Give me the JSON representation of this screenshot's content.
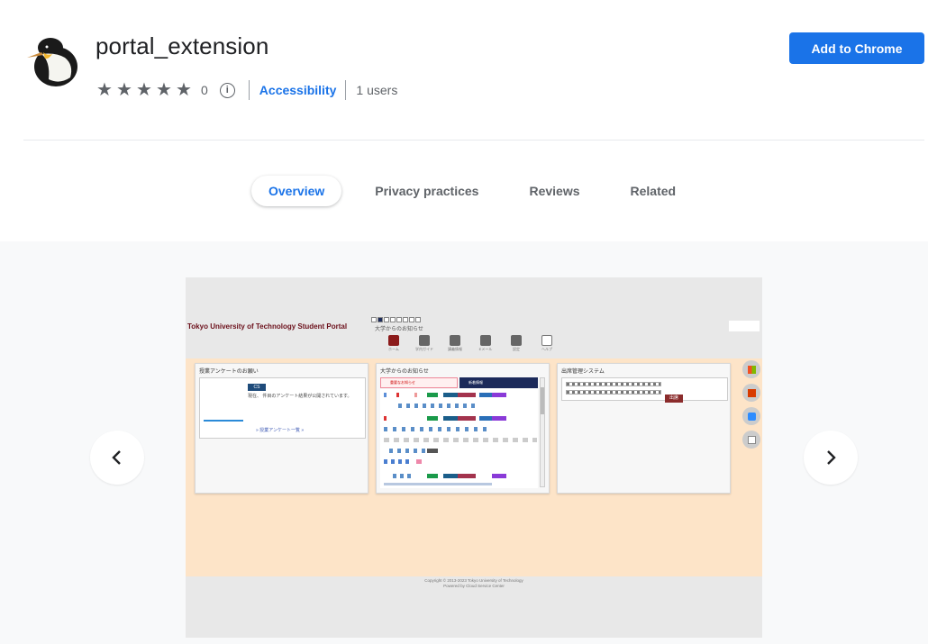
{
  "extension": {
    "title": "portal_extension",
    "rating": "0",
    "category": "Accessibility",
    "users": "1 users",
    "add_button": "Add to Chrome"
  },
  "tabs": [
    {
      "label": "Overview",
      "active": true
    },
    {
      "label": "Privacy practices",
      "active": false
    },
    {
      "label": "Reviews",
      "active": false
    },
    {
      "label": "Related",
      "active": false
    }
  ],
  "screenshot": {
    "portal_title": "Tokyo University of Technology Student Portal",
    "news_label": "大学からのお知らせ",
    "nav": [
      "ホーム",
      "学内ガイド",
      "講義情報",
      "Eメール",
      "設定",
      "ヘルプ"
    ],
    "card1_title": "授業アンケートのお願い",
    "card1_badge": "CS",
    "card1_text": "現在、 件目のアンケート結果が公開されています。",
    "card1_link": "» 授業アンケート一覧 »",
    "card2_title": "大学からのお知らせ",
    "card2_tab1": "重要なお知らせ",
    "card2_tab2": "新着情報",
    "card3_title": "出席管理システム",
    "card3_button": "出席",
    "footer_line1": "Copyright © 2013-2023 Tokyo University of Technology",
    "footer_line2": "Powered by Cloud Service Center"
  },
  "colors": {
    "accent": "#1a73e8",
    "portal_bg": "#fde4c8",
    "gallery_bg": "#f8f9fa"
  }
}
